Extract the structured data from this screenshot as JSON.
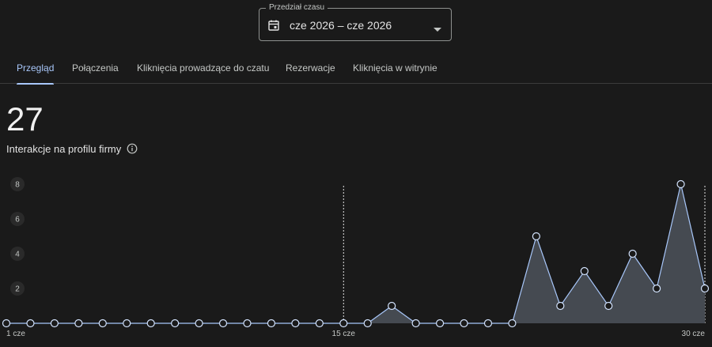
{
  "date_range": {
    "label": "Przedział czasu",
    "value": "cze 2026 – cze 2026",
    "icon": "calendar-icon"
  },
  "tabs": [
    {
      "label": "Przegląd",
      "active": true
    },
    {
      "label": "Połączenia",
      "active": false
    },
    {
      "label": "Kliknięcia prowadzące do czatu",
      "active": false
    },
    {
      "label": "Rezerwacje",
      "active": false
    },
    {
      "label": "Kliknięcia w witrynie",
      "active": false
    }
  ],
  "metric": {
    "value": "27",
    "label": "Interakcje na profilu firmy"
  },
  "colors": {
    "accent": "#a8c7fa",
    "area": "#454a51",
    "background": "#1a1a1a"
  },
  "chart_data": {
    "type": "area",
    "x": [
      1,
      2,
      3,
      4,
      5,
      6,
      7,
      8,
      9,
      10,
      11,
      12,
      13,
      14,
      15,
      16,
      17,
      18,
      19,
      20,
      21,
      22,
      23,
      24,
      25,
      26,
      27,
      28,
      29,
      30
    ],
    "values": [
      0,
      0,
      0,
      0,
      0,
      0,
      0,
      0,
      0,
      0,
      0,
      0,
      0,
      0,
      0,
      0,
      1,
      0,
      0,
      0,
      0,
      0,
      5,
      1,
      3,
      1,
      4,
      2,
      8,
      2
    ],
    "ylim": [
      0,
      8
    ],
    "yticks": [
      "8",
      "6",
      "4",
      "2"
    ],
    "ytick_values": [
      8,
      6,
      4,
      2
    ],
    "xtick_labels": [
      "1 cze",
      "15 cze",
      "30 cze"
    ],
    "xtick_values": [
      1,
      15,
      30
    ],
    "markers": [
      15,
      30
    ],
    "grid": false
  }
}
